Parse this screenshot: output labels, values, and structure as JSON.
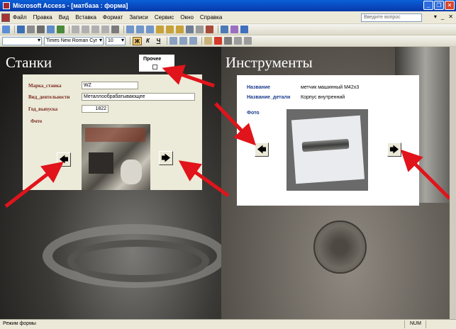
{
  "window": {
    "title": "Microsoft Access - [матбаза : форма]",
    "controls": [
      "_",
      "❐",
      "✕"
    ]
  },
  "menu": {
    "items": [
      "Файл",
      "Правка",
      "Вид",
      "Вставка",
      "Формат",
      "Записи",
      "Сервис",
      "Окно",
      "Справка"
    ],
    "help_placeholder": "Введите вопрос",
    "right_controls": [
      "▾",
      "_",
      "✕"
    ]
  },
  "format_toolbar": {
    "object_combo": "",
    "font_name": "Times New Roman Cyr",
    "font_size": "10",
    "bold": "Ж",
    "italic": "К",
    "underline": "Ч"
  },
  "headings": {
    "machines": "Станки",
    "tools": "Инструменты"
  },
  "other": {
    "label": "Прочее",
    "checked": false
  },
  "machine_form": {
    "fields": [
      {
        "label": "Марка_станка",
        "value": "WZ"
      },
      {
        "label": "Вид_деятельности",
        "value": "Металлообрабатывающее"
      },
      {
        "label": "Год_выпуска",
        "value": "1822"
      }
    ],
    "photo_label": "Фото"
  },
  "tools_form": {
    "fields": [
      {
        "label": "Название",
        "value": "метчик машинный М42х3"
      },
      {
        "label": "Название_детали",
        "value": "Корпус внутренний"
      }
    ],
    "photo_label": "Фото"
  },
  "nav": {
    "prev": "🡄",
    "next": "🡆"
  },
  "status": {
    "mode": "Режим формы",
    "num": "NUM"
  },
  "colors": {
    "arrow": "#e0141a",
    "titlebar": "#0a5fd8",
    "label_machine": "#7b2a20",
    "label_tool": "#1a3a8c"
  }
}
